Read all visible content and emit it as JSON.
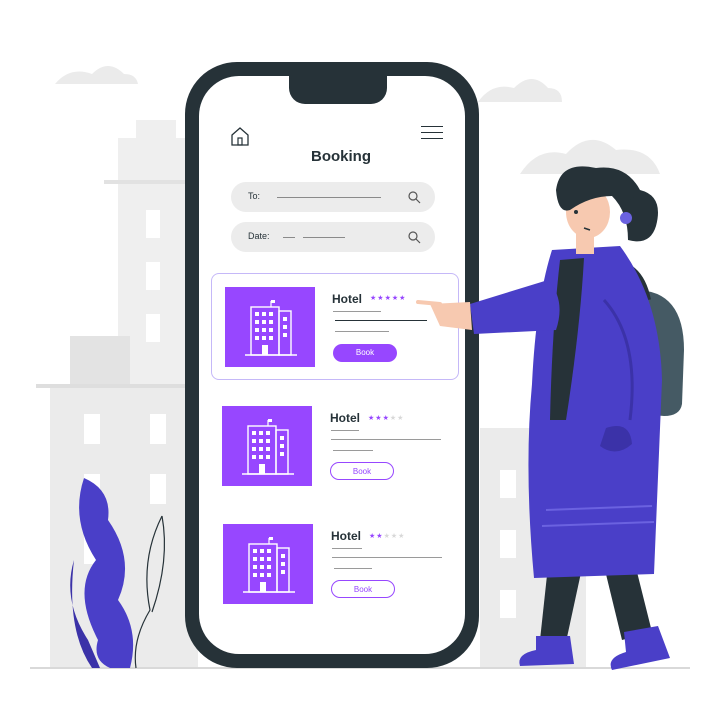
{
  "app": {
    "title": "Booking",
    "search_fields": [
      {
        "label": "To:"
      },
      {
        "label": "Date:"
      }
    ]
  },
  "hotels": [
    {
      "name": "Hotel",
      "stars": "★★★★★",
      "stars_filled": 5,
      "book_label": "Book",
      "selected": true
    },
    {
      "name": "Hotel",
      "stars": "★★★★★",
      "stars_filled": 3,
      "book_label": "Book",
      "selected": false
    },
    {
      "name": "Hotel",
      "stars": "★★★★★",
      "stars_filled": 2,
      "book_label": "Book",
      "selected": false
    }
  ],
  "icons": {
    "home": "home-icon",
    "menu": "hamburger-menu-icon",
    "search": "search-icon",
    "building": "building-icon"
  },
  "colors": {
    "accent": "#9747ff",
    "coat": "#4a3fc8",
    "dark": "#263238",
    "field": "#ececec",
    "background_buildings": "#ebebeb"
  }
}
